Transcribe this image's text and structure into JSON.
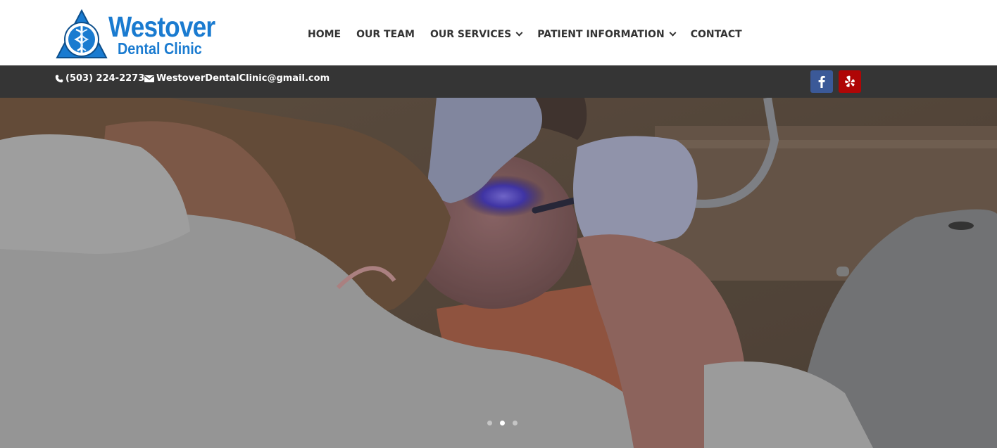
{
  "brand": {
    "name_line1": "Westover",
    "name_line2": "Dental Clinic",
    "logo_icon": "caduceus-triangle-emblem",
    "color": "#1a7bd0"
  },
  "nav": {
    "items": [
      {
        "label": "HOME",
        "has_dropdown": false
      },
      {
        "label": "OUR TEAM",
        "has_dropdown": false
      },
      {
        "label": "OUR SERVICES",
        "has_dropdown": true
      },
      {
        "label": "PATIENT INFORMATION",
        "has_dropdown": true
      },
      {
        "label": "CONTACT",
        "has_dropdown": false
      }
    ]
  },
  "topbar": {
    "background": "#353535",
    "phone": "(503) 224-2273",
    "email": "WestoverDentalClinic@gmail.com",
    "social": [
      {
        "name": "facebook-icon",
        "color": "#3b5998"
      },
      {
        "name": "yelp-icon",
        "color": "#af0606"
      }
    ]
  },
  "hero": {
    "image": "dentist treating patient with curing light",
    "slide_count": 3,
    "active_slide": 2
  }
}
